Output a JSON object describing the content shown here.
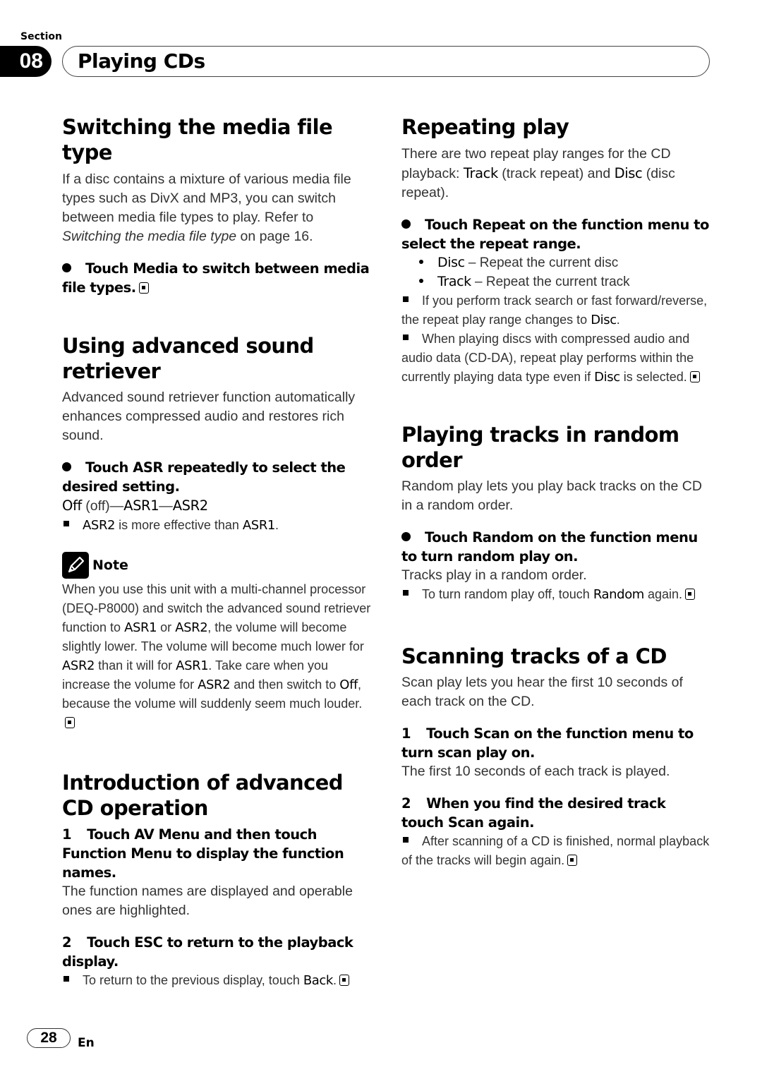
{
  "header": {
    "section_label": "Section",
    "section_number": "08",
    "section_title": "Playing CDs"
  },
  "left": {
    "media": {
      "title": "Switching the media file type",
      "body_pre": "If a disc contains a mixture of various media file types such as DivX and MP3, you can switch between media file types to play. Refer to ",
      "body_ref": "Switching the media file type",
      "body_post": " on page 16.",
      "instruction": "Touch Media to switch between media file types."
    },
    "asr": {
      "title": "Using advanced sound retriever",
      "body": "Advanced sound retriever function automatically enhances compressed audio and restores rich sound.",
      "instruction": "Touch ASR repeatedly to select the desired setting.",
      "sequence_off": "Off",
      "sequence_off_paren": " (off)—",
      "sequence_asr1": "ASR1",
      "sequence_dash": "—",
      "sequence_asr2": "ASR2",
      "tip_b1": "ASR2",
      "tip_mid": " is more effective than ",
      "tip_b2": "ASR1",
      "tip_end": "."
    },
    "note": {
      "label": "Note",
      "t1": "When you use this unit with a multi-channel processor (DEQ-P8000) and switch the advanced sound retriever function to ",
      "b1": "ASR1",
      "t2": " or ",
      "b2": "ASR2",
      "t3": ", the volume will become slightly lower. The volume will become much lower for ",
      "b3": "ASR2",
      "t4": " than it will for ",
      "b4": "ASR1",
      "t5": ". Take care when you increase the volume for ",
      "b5": "ASR2",
      "t6": " and then switch to ",
      "b6": "Off",
      "t7": ", because the volume will suddenly seem much louder."
    },
    "intro": {
      "title": "Introduction of advanced CD operation",
      "step1_num": "1",
      "step1": "Touch AV Menu and then touch Function Menu to display the function names.",
      "step1_body": "The function names are displayed and operable ones are highlighted.",
      "step2_num": "2",
      "step2": "Touch ESC to return to the playback display.",
      "step2_tip": "To return to the previous display, touch ",
      "step2_tip_b": "Back",
      "step2_tip_end": "."
    }
  },
  "right": {
    "repeat": {
      "title": "Repeating play",
      "t1": "There are two repeat play ranges for the CD playback: ",
      "b1": "Track",
      "t2": " (track repeat) and ",
      "b2": "Disc",
      "t3": " (disc repeat).",
      "instruction": "Touch Repeat on the function menu to select the repeat range.",
      "options": [
        {
          "name": "Disc",
          "desc": " – Repeat the current disc"
        },
        {
          "name": "Track",
          "desc": " – Repeat the current track"
        }
      ],
      "tip1": "If you perform track search or fast forward/reverse, the repeat play range changes to ",
      "tip1_b": "Disc",
      "tip1_end": ".",
      "tip2": "When playing discs with compressed audio and audio data (CD-DA), repeat play performs within the currently playing data type even if ",
      "tip2_b": "Disc",
      "tip2_end": " is selected."
    },
    "random": {
      "title": "Playing tracks in random order",
      "body": "Random play lets you play back tracks on the CD in a random order.",
      "instruction": "Touch Random on the function menu to turn random play on.",
      "result": "Tracks play in a random order.",
      "tip": "To turn random play off, touch ",
      "tip_b": "Random",
      "tip_end": " again."
    },
    "scan": {
      "title": "Scanning tracks of a CD",
      "body": "Scan play lets you hear the first 10 seconds of each track on the CD.",
      "step1_num": "1",
      "step1": "Touch Scan on the function menu to turn scan play on.",
      "step1_body": "The first 10 seconds of each track is played.",
      "step2_num": "2",
      "step2": "When you find the desired track touch Scan again.",
      "step2_tip": "After scanning of a CD is finished, normal playback of the tracks will begin again."
    }
  },
  "footer": {
    "page_number": "28",
    "language": "En"
  }
}
